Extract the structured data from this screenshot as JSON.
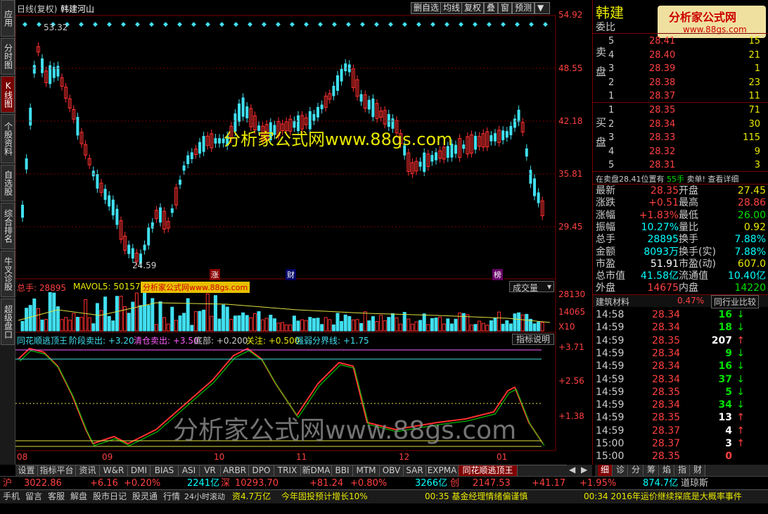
{
  "leftnav": [
    "应用",
    "分时图",
    "K线图",
    "个股资料",
    "自选股",
    "综合排名",
    "牛叉诊股",
    "超级盘口"
  ],
  "topbar": {
    "title": "日线(复权)",
    "stock": "韩建河山",
    "buttons": [
      "删自选",
      "均线",
      "复权",
      "叠",
      "窗",
      "预测"
    ]
  },
  "kline": {
    "price_labels": [
      "54.92",
      "48.55",
      "42.18",
      "35.81",
      "29.45"
    ],
    "high_mark": "53.32",
    "low_mark": "24.59",
    "events": [
      "涨",
      "财",
      "榜"
    ]
  },
  "volume": {
    "label_total": "总手: 28895",
    "label_mavol": "MAVOL5: 50157",
    "select": "成交量",
    "axis": [
      "28130",
      "14065",
      "X10"
    ]
  },
  "indicator": {
    "name": "同花顺逃顶王",
    "items": [
      "阶段卖出: +3.20",
      "清仓卖出: +3.50",
      "底部: +0.200",
      "关注: +0.500",
      "强弱分界线: +1.75"
    ],
    "btn": "指标说明",
    "axis": [
      "+3.71",
      "+2.56",
      "+1.38"
    ]
  },
  "xaxis": [
    "08",
    "09",
    "10",
    "11",
    "12",
    "01"
  ],
  "watermark": {
    "kline": "分析家公式网www.88gs.com",
    "ind": "分析家公式网www.88gs.com",
    "vol": "分析家公式网www.88gs.com",
    "logo": "分析家公式网",
    "logo_url": "www.88gs.com"
  },
  "quote": {
    "name": "韩建",
    "wb": "委比",
    "sell": [
      [
        "5",
        "28.41",
        "15"
      ],
      [
        "4",
        "28.40",
        "21"
      ],
      [
        "3",
        "28.39",
        "1"
      ],
      [
        "2",
        "28.38",
        "23"
      ],
      [
        "1",
        "28.37",
        "11"
      ]
    ],
    "buy": [
      [
        "1",
        "28.35",
        "71"
      ],
      [
        "2",
        "28.34",
        "30"
      ],
      [
        "3",
        "28.33",
        "115"
      ],
      [
        "4",
        "28.32",
        "9"
      ],
      [
        "5",
        "28.31",
        "3"
      ]
    ],
    "side_sell": "卖盘",
    "side_buy": "买盘",
    "info": "在卖盘28.41位置有",
    "info_vol": "55手",
    "info_tail": "卖单! 查看详细",
    "stats": [
      [
        "最新",
        "28.35",
        "开盘",
        "27.45"
      ],
      [
        "涨跌",
        "+0.51",
        "最高",
        "28.86"
      ],
      [
        "涨幅",
        "+1.83%",
        "最低",
        "26.00"
      ],
      [
        "振幅",
        "10.27%",
        "量比",
        "0.92"
      ],
      [
        "总手",
        "28895",
        "换手",
        "7.88%"
      ],
      [
        "金额",
        "8093万",
        "换手(实)",
        "7.88%"
      ],
      [
        "市盈",
        "51.91",
        "市盈(动)",
        "607.0"
      ],
      [
        "总市值",
        "41.58亿",
        "流通值",
        "10.40亿"
      ],
      [
        "外盘",
        "14675",
        "内盘",
        "14220"
      ]
    ],
    "industry": "建筑材料",
    "industry_pct": "0.47%",
    "industry_btn": "同行业比较",
    "ticks": [
      [
        "14:58",
        "28.34",
        "16",
        "dn"
      ],
      [
        "14:59",
        "28.34",
        "18",
        "dn"
      ],
      [
        "14:59",
        "28.35",
        "207",
        "up"
      ],
      [
        "14:59",
        "28.34",
        "9",
        "dn"
      ],
      [
        "14:59",
        "28.34",
        "16",
        "dn"
      ],
      [
        "14:59",
        "28.34",
        "37",
        "dn"
      ],
      [
        "14:59",
        "28.35",
        "5",
        "dn"
      ],
      [
        "14:59",
        "28.34",
        "34",
        "dn"
      ],
      [
        "14:59",
        "28.35",
        "13",
        "up"
      ],
      [
        "14:59",
        "28.37",
        "4",
        "up"
      ],
      [
        "15:00",
        "28.37",
        "3",
        "up"
      ],
      [
        "15:00",
        "28.35",
        "0",
        ""
      ]
    ]
  },
  "tabs": [
    "设置",
    "指标平台",
    "资讯",
    "W&R",
    "DMI",
    "BIAS",
    "ASI",
    "VR",
    "ARBR",
    "DPO",
    "TRIX",
    "新DMA",
    "BBI",
    "MTM",
    "OBV",
    "SAR",
    "EXPMA",
    "同花顺逃顶王"
  ],
  "rtabs": [
    "细",
    "诊",
    "分",
    "筹",
    "焰",
    "指",
    "财"
  ],
  "status": {
    "sh": "沪",
    "sh_v": "3022.86",
    "sh_c": "+6.16",
    "sh_p": "+0.20%",
    "sh_a": "2241亿",
    "sz": "深",
    "sz_v": "10293.70",
    "sz_c": "+81.24",
    "sz_p": "+0.80%",
    "sz_a": "3266亿",
    "cy": "创",
    "cy_v": "2147.53",
    "cy_c": "+41.17",
    "cy_p": "+1.95%",
    "cy_a": "874.7亿",
    "dj": "道琼斯"
  },
  "bottom": {
    "items": [
      "手机",
      "留言",
      "客服",
      "解盘",
      "股市日记",
      "股灵通",
      "行情",
      "24小时滚动"
    ],
    "news1": "资4.7万亿",
    "news2": "今年固投预计增长10%",
    "news3": "00:35 基金经理情绪偏谨慎",
    "news4": "00:34 2016年运价继续探底是大概率事件"
  },
  "colors": {
    "up": "#ff3030",
    "down": "#40e0f0",
    "axis": "#7a0000"
  }
}
